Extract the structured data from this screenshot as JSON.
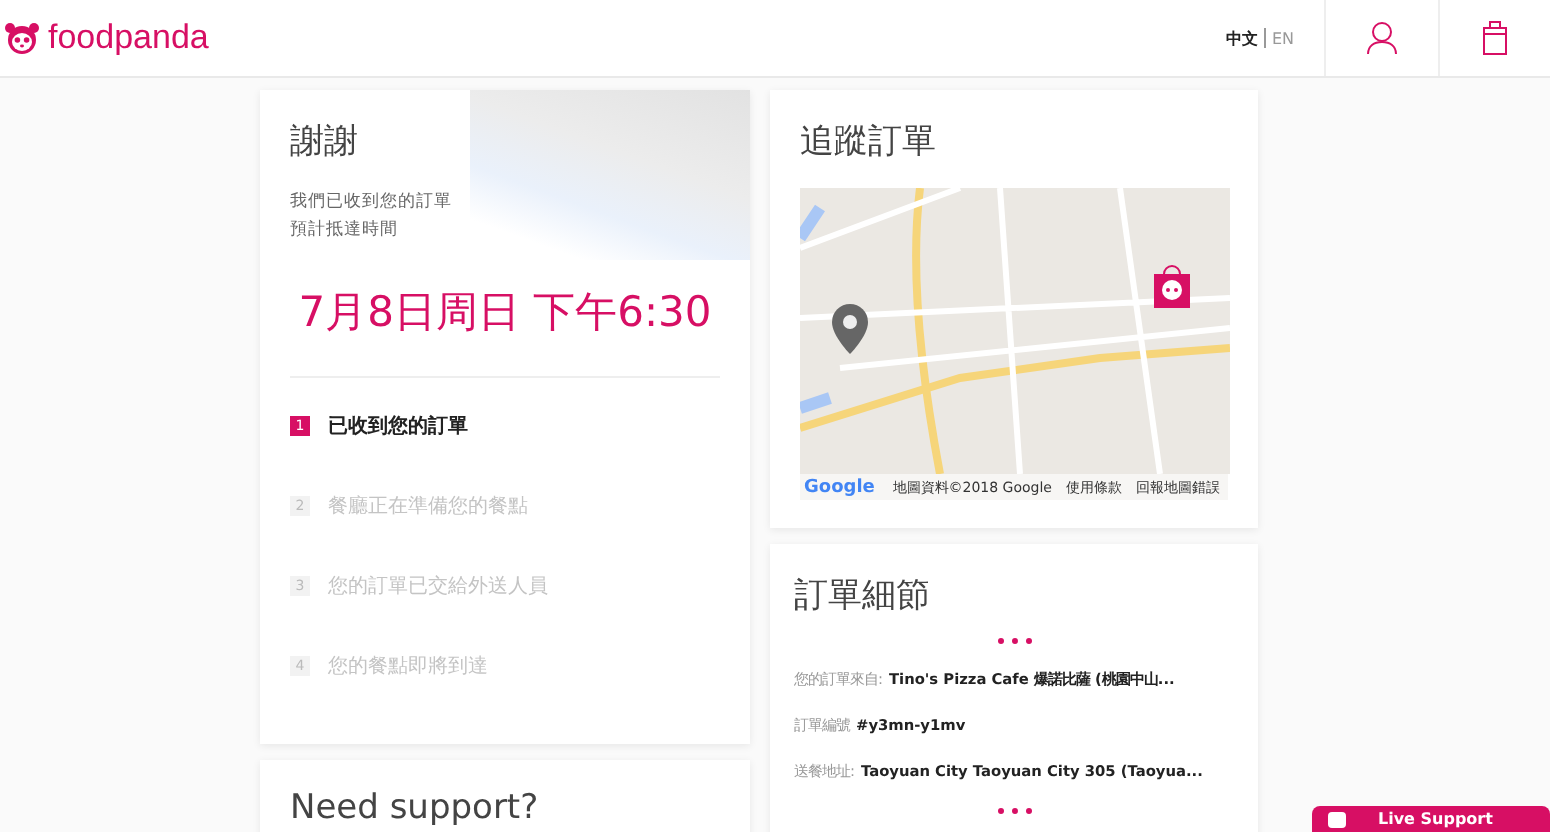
{
  "header": {
    "brand": "foodpanda",
    "languages": [
      {
        "label": "中文",
        "selected": true
      },
      {
        "label": "EN",
        "selected": false
      }
    ]
  },
  "confirmation": {
    "title": "謝謝",
    "messages": [
      "我們已收到您的訂單",
      "預計抵達時間"
    ],
    "eta": "7月8日周日 下午6:30",
    "steps": [
      {
        "number": "1",
        "label": "已收到您的訂單",
        "active": true
      },
      {
        "number": "2",
        "label": "餐廳正在準備您的餐點",
        "active": false
      },
      {
        "number": "3",
        "label": "您的訂單已交給外送人員",
        "active": false
      },
      {
        "number": "4",
        "label": "您的餐點即將到達",
        "active": false
      }
    ]
  },
  "tracking": {
    "title": "追蹤訂單",
    "map_logo": "Google",
    "map_attribution": [
      "地圖資料©2018 Google",
      "使用條款",
      "回報地圖錯誤"
    ]
  },
  "details": {
    "title": "訂單細節",
    "rows": [
      {
        "label": "您的訂單來自:",
        "value": "Tino's Pizza Cafe 爆諾比薩 (桃園中山..."
      },
      {
        "label": "訂單編號",
        "value": "#y3mn-y1mv"
      },
      {
        "label": "送餐地址:",
        "value": "Taoyuan City Taoyuan City 305 (Taoyua..."
      }
    ]
  },
  "support": {
    "title": "Need support?"
  },
  "live_support": {
    "label": "Live Support"
  }
}
